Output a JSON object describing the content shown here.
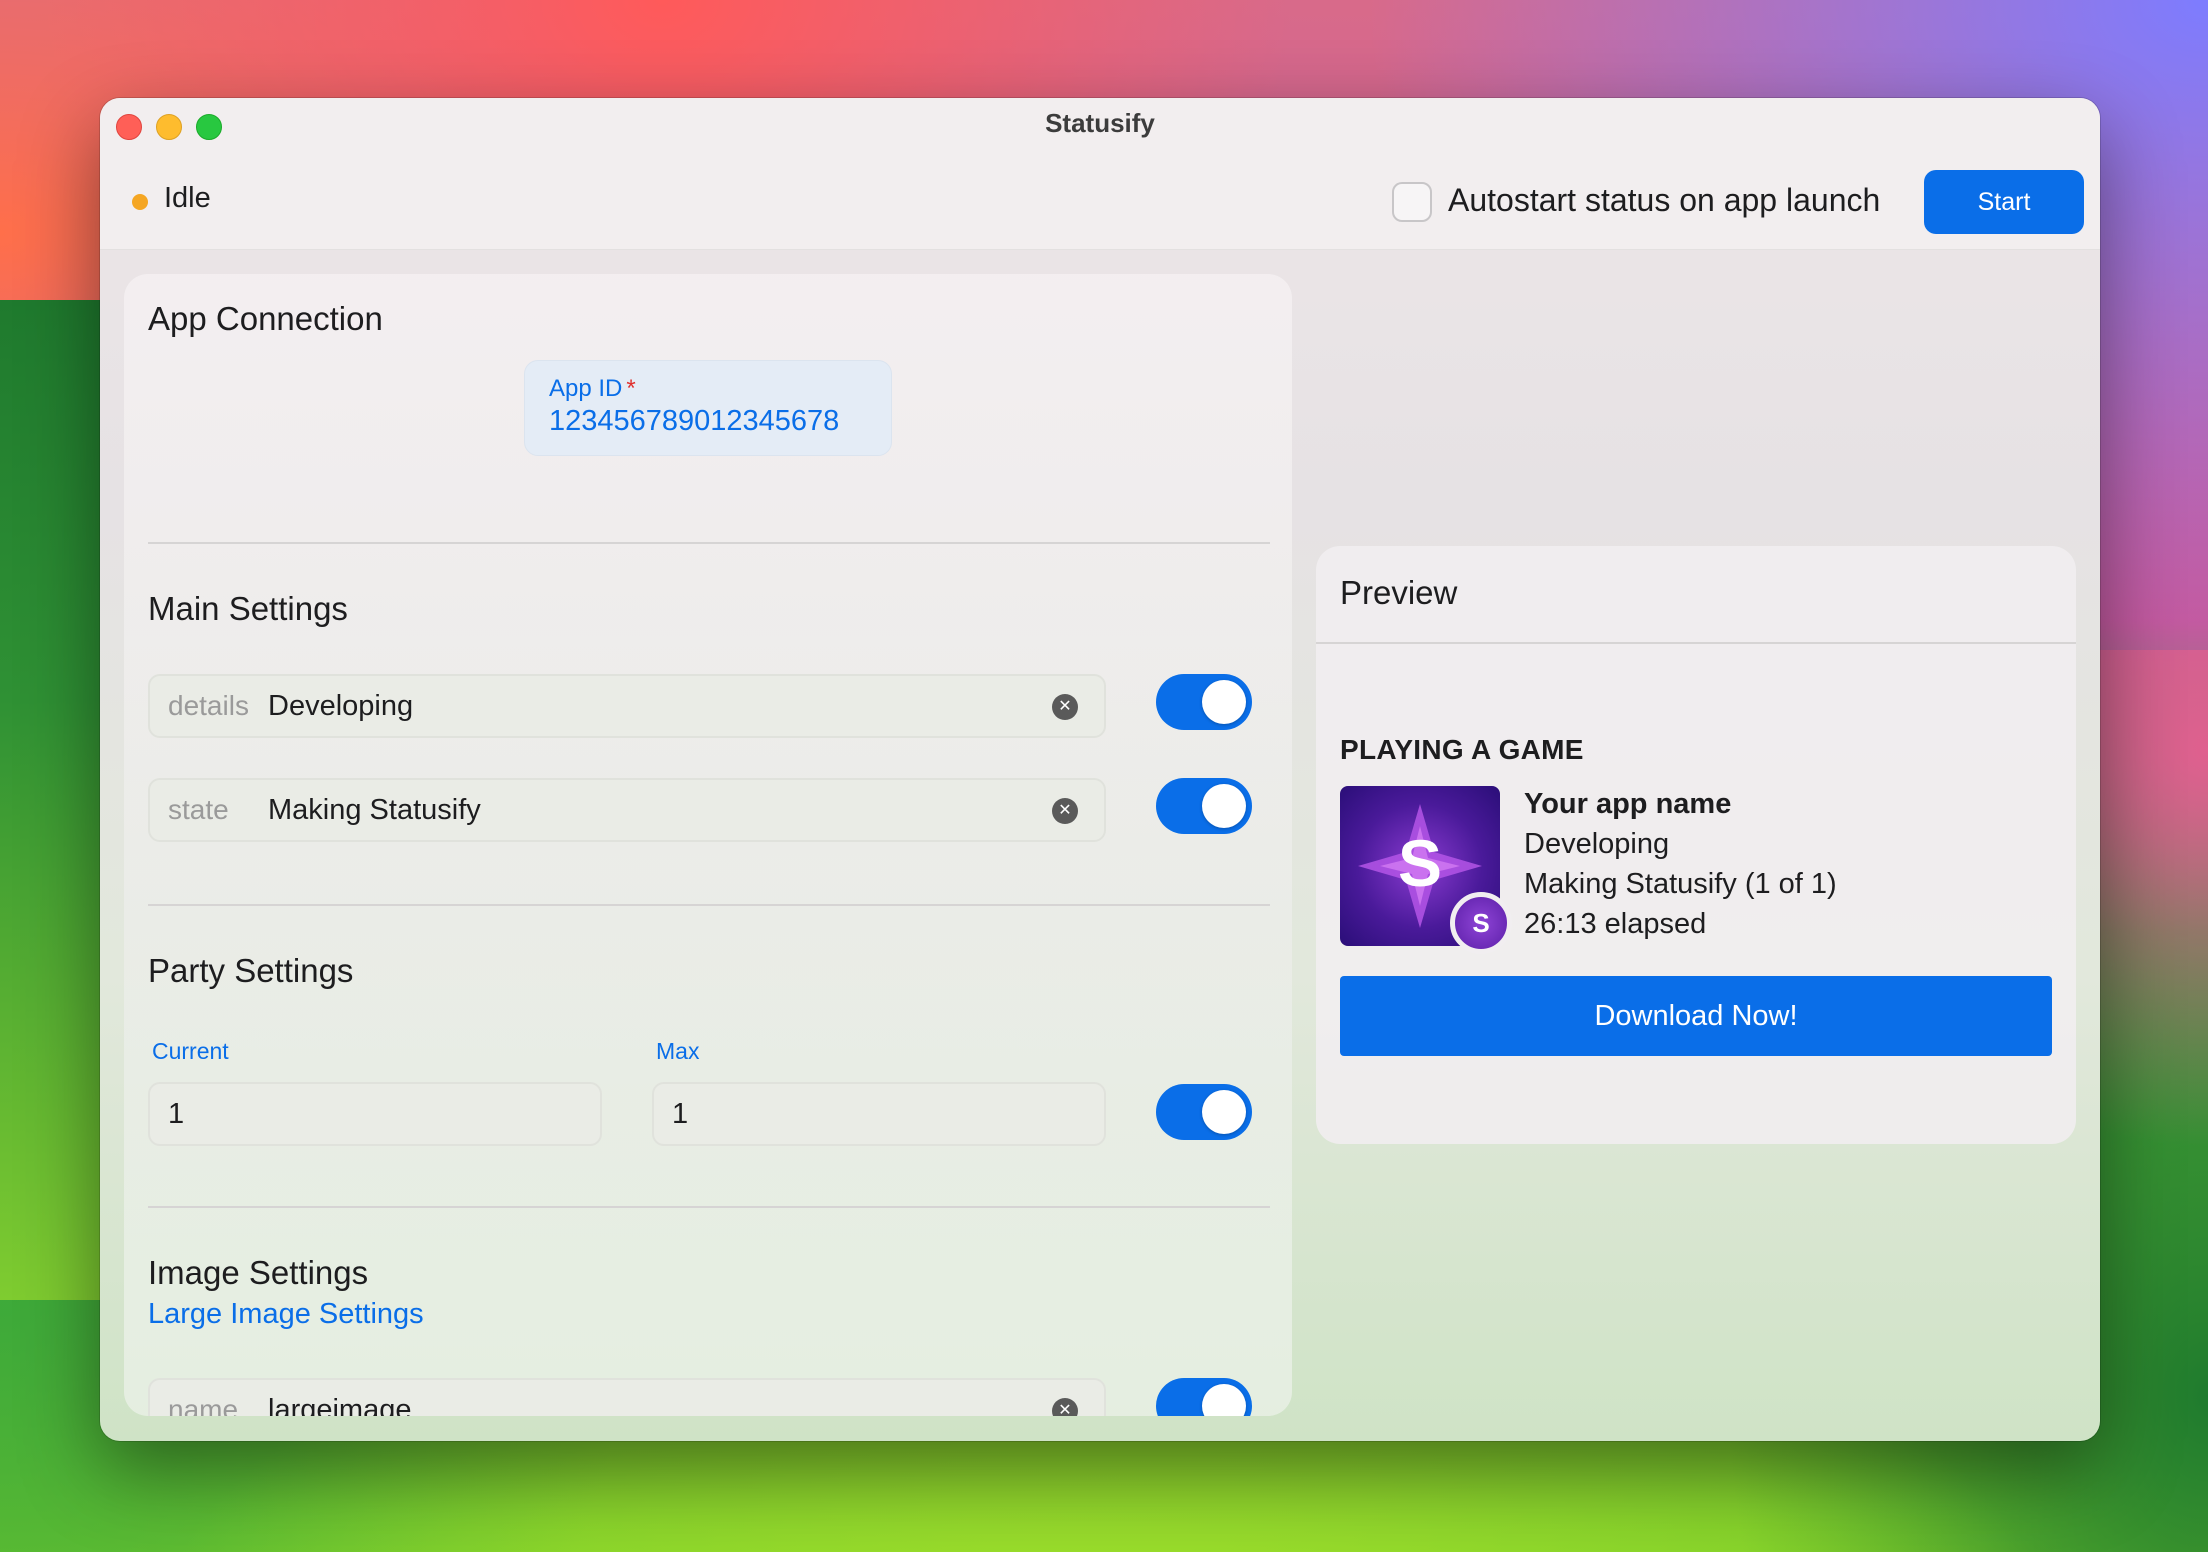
{
  "window": {
    "title": "Statusify"
  },
  "toolbar": {
    "status": "Idle",
    "autostart_label": "Autostart status on app launch",
    "autostart_checked": false,
    "start_label": "Start",
    "status_color": "#f5a623",
    "accent": "#0a6ee8"
  },
  "app_connection": {
    "title": "App Connection",
    "app_id_label": "App ID",
    "required_mark": "*",
    "app_id_value": "123456789012345678"
  },
  "main_settings": {
    "title": "Main Settings",
    "fields": [
      {
        "prefix": "details",
        "value": "Developing",
        "enabled": true
      },
      {
        "prefix": "state",
        "value": "Making Statusify",
        "enabled": true
      }
    ]
  },
  "party_settings": {
    "title": "Party Settings",
    "current_label": "Current",
    "current_value": "1",
    "max_label": "Max",
    "max_value": "1",
    "enabled": true
  },
  "image_settings": {
    "title": "Image Settings",
    "link": "Large Image Settings",
    "field": {
      "prefix": "name",
      "value": "largeimage",
      "enabled": true
    }
  },
  "preview": {
    "title": "Preview",
    "activity_type": "PLAYING A GAME",
    "app_name": "Your app name",
    "details": "Developing",
    "state": "Making Statusify (1 of 1)",
    "elapsed": "26:13 elapsed",
    "icon_letter": "S",
    "small_icon_letter": "S",
    "download_label": "Download Now!"
  }
}
